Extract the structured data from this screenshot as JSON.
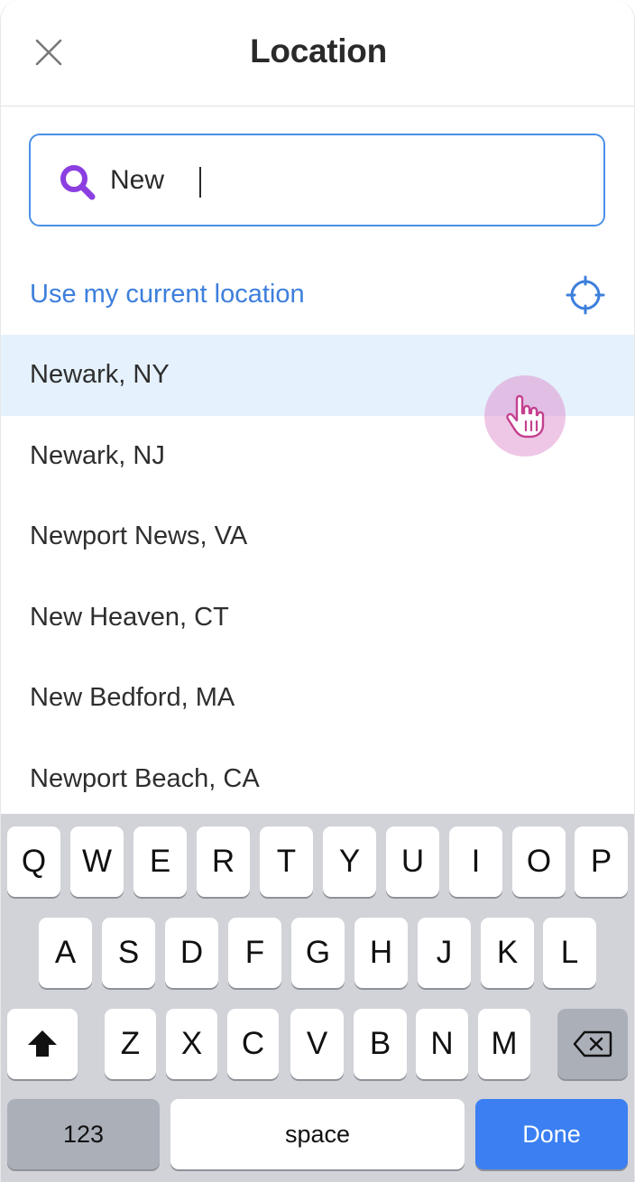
{
  "header": {
    "title": "Location",
    "close_icon": "close-icon"
  },
  "search": {
    "value": "New",
    "icon": "search-icon",
    "icon_color": "#8b3fe0"
  },
  "current_location": {
    "label": "Use my current location",
    "icon": "crosshair-icon",
    "color": "#3d7fdc"
  },
  "results": [
    "Newark, NY",
    "Newark, NJ",
    "Newport News, VA",
    "New Heaven, CT",
    "New Bedford, MA",
    "Newport Beach, CA"
  ],
  "keyboard": {
    "row1": [
      "Q",
      "W",
      "E",
      "R",
      "T",
      "Y",
      "U",
      "I",
      "O",
      "P"
    ],
    "row2": [
      "A",
      "S",
      "D",
      "F",
      "G",
      "H",
      "J",
      "K",
      "L"
    ],
    "row3": [
      "Z",
      "X",
      "C",
      "V",
      "B",
      "N",
      "M"
    ],
    "shift_icon": "shift-icon",
    "backspace_icon": "backspace-icon",
    "numbers_label": "123",
    "space_label": "space",
    "done_label": "Done",
    "done_color": "#3b7ff2"
  }
}
